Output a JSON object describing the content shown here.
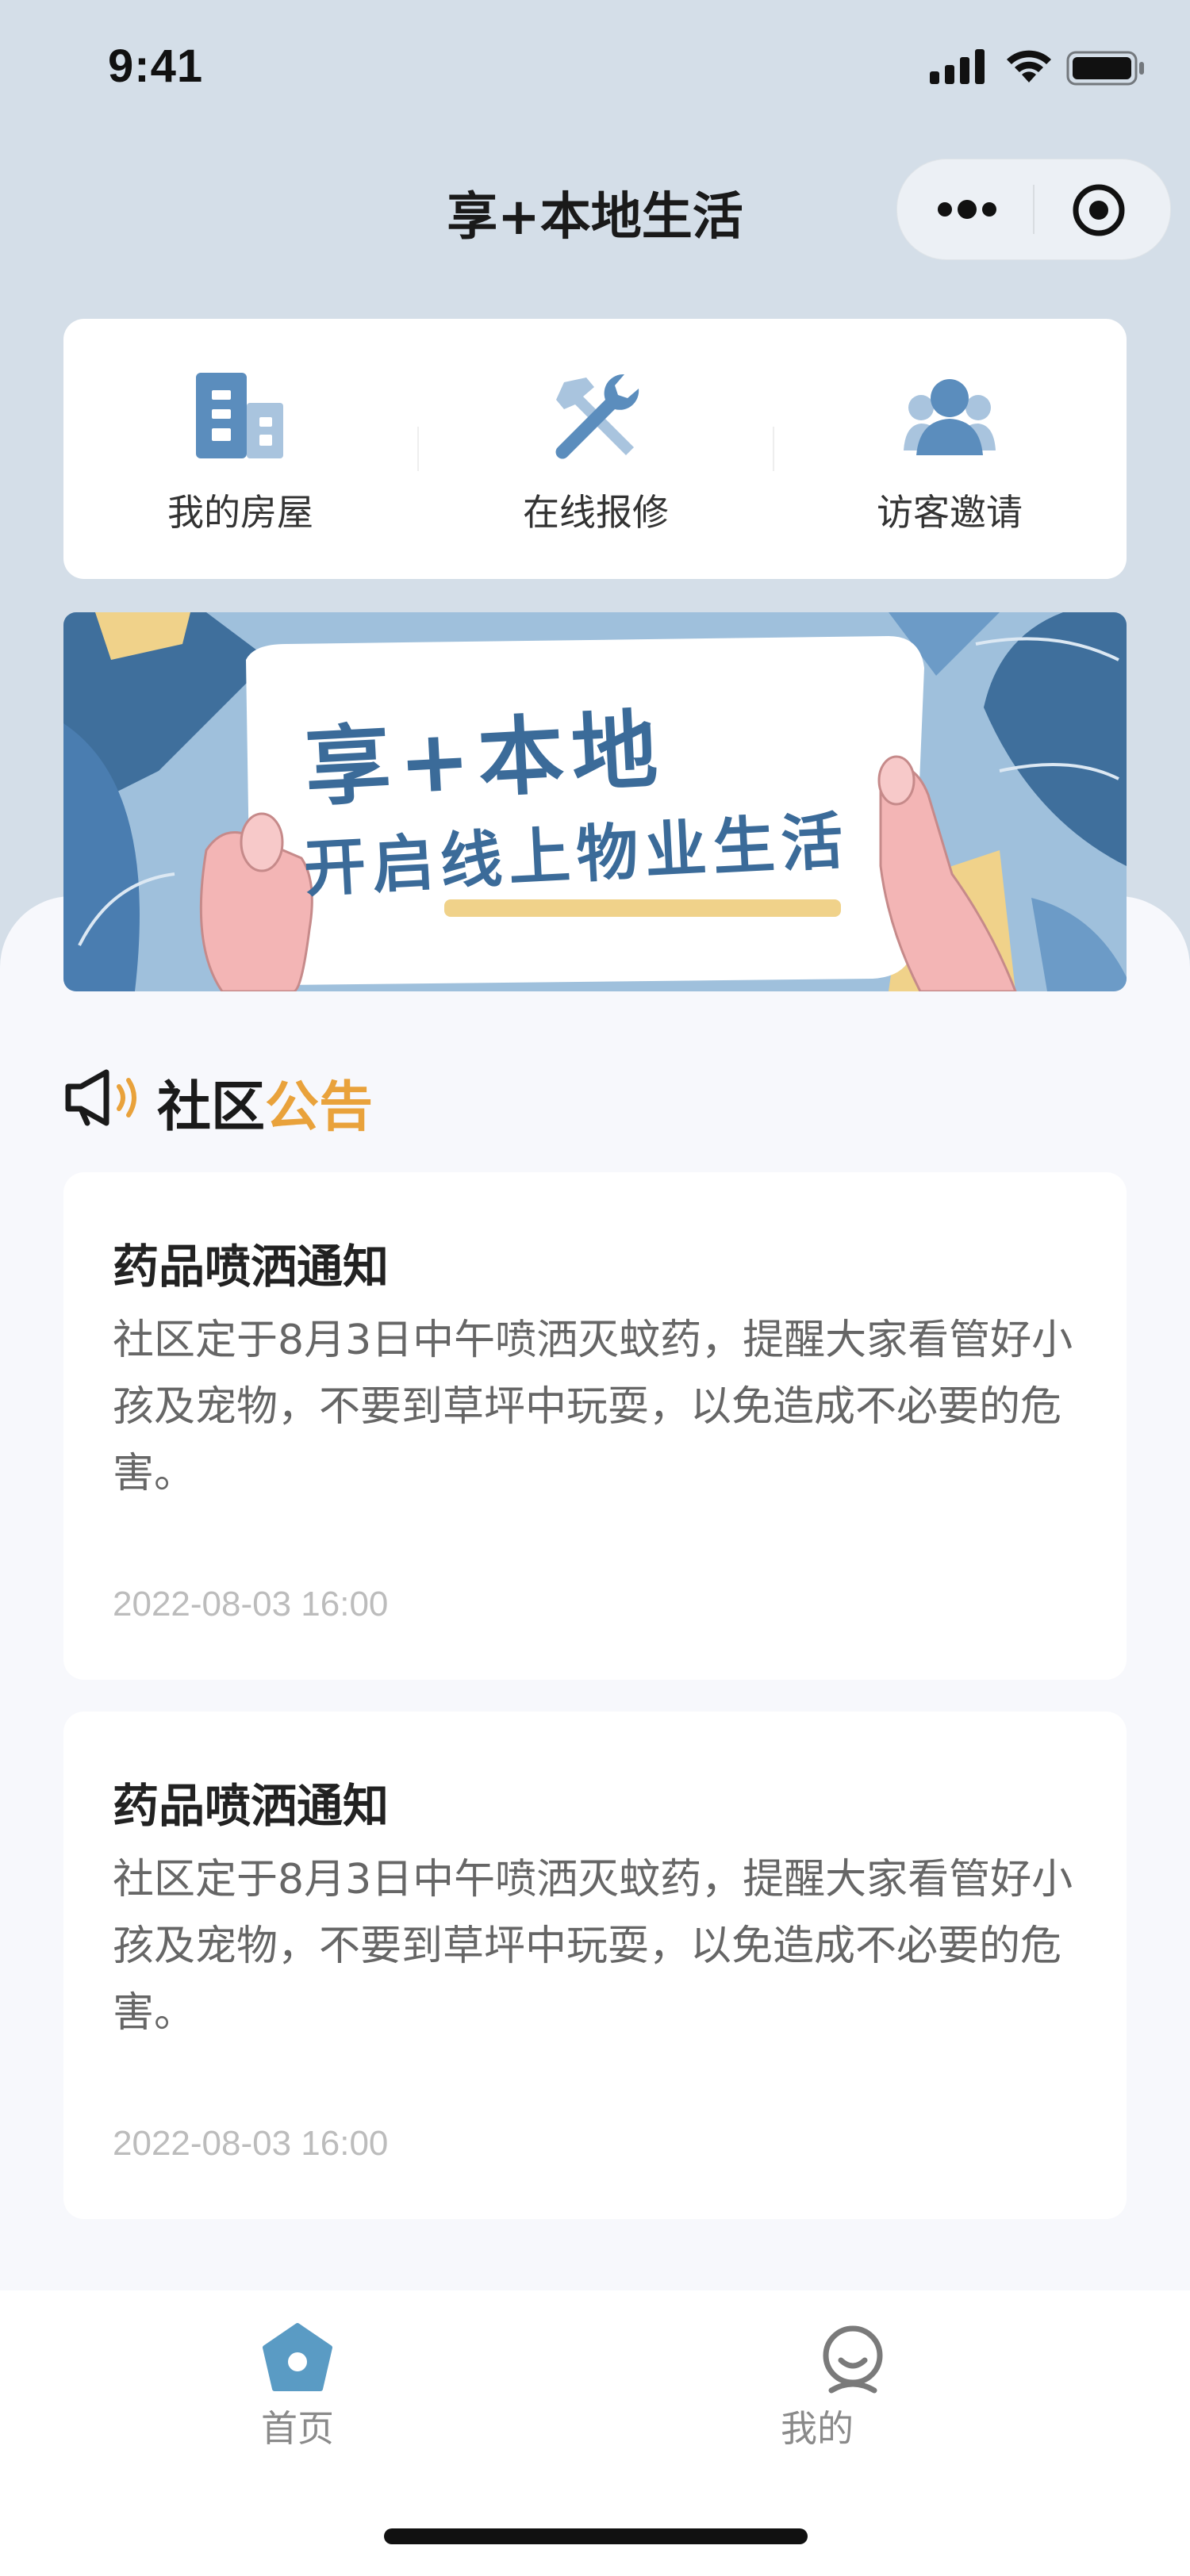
{
  "status_bar": {
    "time": "9:41"
  },
  "nav": {
    "title": "享+本地生活"
  },
  "quick_menu": [
    {
      "label": "我的房屋",
      "icon": "building-icon"
    },
    {
      "label": "在线报修",
      "icon": "tools-icon"
    },
    {
      "label": "访客邀请",
      "icon": "visitors-icon"
    }
  ],
  "banner": {
    "title": "享+本地",
    "subtitle": "开启线上物业生活"
  },
  "notice": {
    "title_part1": "社区",
    "title_part2": "公告",
    "items": [
      {
        "title": "药品喷洒通知",
        "body": "社区定于8月3日中午喷洒灭蚊药，提醒大家看管好小孩及宠物，不要到草坪中玩耍，以免造成不必要的危害。",
        "date": "2022-08-03 16:00"
      },
      {
        "title": "药品喷洒通知",
        "body": "社区定于8月3日中午喷洒灭蚊药，提醒大家看管好小孩及宠物，不要到草坪中玩耍，以免造成不必要的危害。",
        "date": "2022-08-03 16:00"
      }
    ]
  },
  "tabbar": [
    {
      "label": "首页",
      "active": true
    },
    {
      "label": "我的",
      "active": false
    }
  ],
  "colors": {
    "accent_blue": "#5b8dbd",
    "accent_orange": "#e9a23b",
    "header_bg": "#d4dee8",
    "active_tab": "#5a9bc4"
  }
}
